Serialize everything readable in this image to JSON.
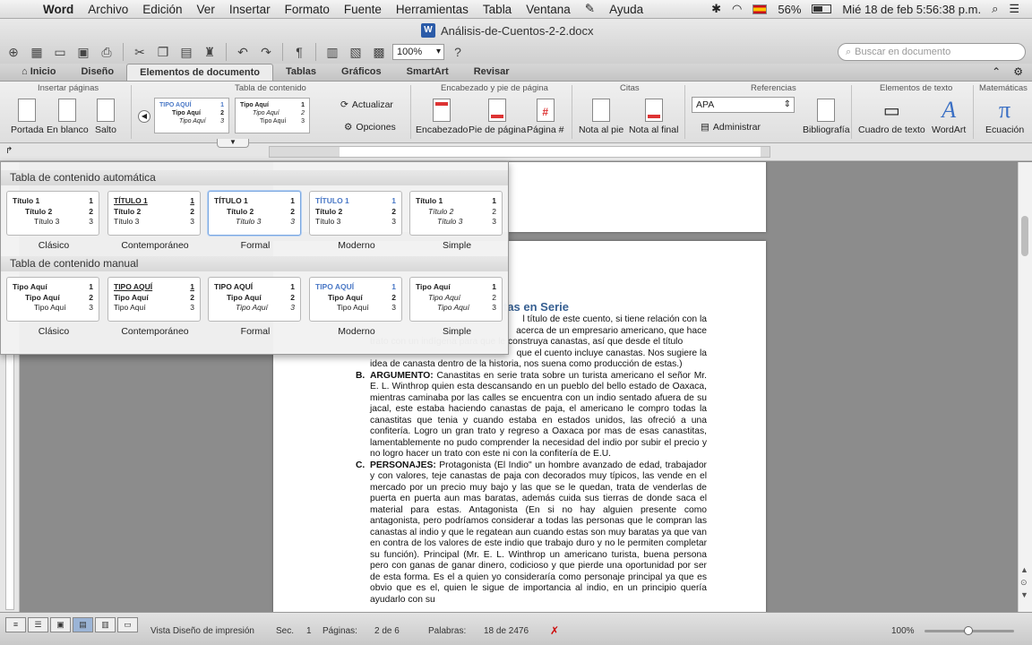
{
  "menubar": {
    "items": [
      "Word",
      "Archivo",
      "Edición",
      "Ver",
      "Insertar",
      "Formato",
      "Fuente",
      "Herramientas",
      "Tabla",
      "Ventana",
      "Ayuda"
    ],
    "battery": "56%",
    "clock": "Mié 18 de feb  5:56:38 p.m."
  },
  "window": {
    "title": "Análisis-de-Cuentos-2-2.docx",
    "zoom": "100%",
    "search_placeholder": "Buscar en documento"
  },
  "ribbon_tabs": [
    "Inicio",
    "Diseño",
    "Elementos de documento",
    "Tablas",
    "Gráficos",
    "SmartArt",
    "Revisar"
  ],
  "ribbon": {
    "groups": {
      "insertar_paginas": "Insertar páginas",
      "tabla_contenido": "Tabla de contenido",
      "encabezado": "Encabezado y pie de página",
      "citas": "Citas",
      "referencias": "Referencias",
      "elementos_texto": "Elementos de texto",
      "matematicas": "Matemáticas"
    },
    "buttons": {
      "portada": "Portada",
      "en_blanco": "En blanco",
      "salto": "Salto",
      "actualizar": "Actualizar",
      "opciones": "Opciones",
      "encabezado": "Encabezado",
      "pie_pagina": "Pie de página",
      "pagina_num": "Página #",
      "nota_pie": "Nota al pie",
      "nota_final": "Nota al final",
      "administrar": "Administrar",
      "bibliografia": "Bibliografía",
      "cuadro_texto": "Cuadro de texto",
      "wordart": "WordArt",
      "ecuacion": "Ecuación"
    },
    "style_value": "APA",
    "toc_thumb1": [
      "TIPO AQUÍ",
      "Tipo Aquí",
      "Tipo Aquí"
    ],
    "toc_thumb2": [
      "Tipo Aquí",
      "Tipo Aquí",
      "Tipo Aquí"
    ]
  },
  "gallery": {
    "auto_header": "Tabla de contenido automática",
    "manual_header": "Tabla de contenido manual",
    "auto_items": [
      {
        "caption": "Clásico",
        "l1": "Título 1",
        "l2": "Título 2",
        "l3": "Título 3"
      },
      {
        "caption": "Contemporáneo",
        "l1": "TÍTULO 1",
        "l2": "Título 2",
        "l3": "Título 3"
      },
      {
        "caption": "Formal",
        "l1": "TÍTULO 1",
        "l2": "Título 2",
        "l3": "Título 3"
      },
      {
        "caption": "Moderno",
        "l1": "TÍTULO 1",
        "l2": "Título 2",
        "l3": "Título 3"
      },
      {
        "caption": "Simple",
        "l1": "Título 1",
        "l2": "Título 2",
        "l3": "Título 3"
      }
    ],
    "manual_items": [
      {
        "caption": "Clásico",
        "l1": "Tipo Aquí",
        "l2": "Tipo Aquí",
        "l3": "Tipo Aquí"
      },
      {
        "caption": "Contemporáneo",
        "l1": "TIPO AQUÍ",
        "l2": "Tipo Aquí",
        "l3": "Tipo Aquí"
      },
      {
        "caption": "Formal",
        "l1": "TIPO AQUÍ",
        "l2": "Tipo Aquí",
        "l3": "Tipo Aquí"
      },
      {
        "caption": "Moderno",
        "l1": "TIPO AQUÍ",
        "l2": "Tipo Aquí",
        "l3": "Tipo Aquí"
      },
      {
        "caption": "Simple",
        "l1": "Tipo Aquí",
        "l2": "Tipo Aquí",
        "l3": "Tipo Aquí"
      }
    ],
    "page_nums": [
      "1",
      "2",
      "3"
    ]
  },
  "document": {
    "heading": "tas en Serie",
    "intro_lines": [
      "l título de este cuento, si tiene relación con la",
      "acerca de un empresario americano, que hace",
      "trato con un indígena para que le construya canastas, así que desde el título",
      "que el cuento incluye canastas. Nos sugiere la",
      "idea de canasta dentro de la historia, nos suena como producción de estas.)"
    ],
    "sections": [
      {
        "label": "B.",
        "title": "ARGUMENTO:",
        "text": "Canastitas en serie trata sobre un turista americano el señor Mr. E. L. Winthrop quien esta descansando en un pueblo del bello estado de Oaxaca, mientras caminaba por las calles se encuentra con un indio sentado afuera de su  jacal, este estaba haciendo canastas de paja, el americano le compro todas la canastitas que tenia y cuando estaba en estados unidos, las ofreció a una confitería. Logro un gran trato y regreso a Oaxaca por mas de esas canastitas, lamentablemente no pudo comprender la necesidad del indio por subir el precio y no logro hacer un trato con este ni con la confitería de E.U."
      },
      {
        "label": "C.",
        "title": "PERSONAJES:",
        "text": "Protagonista (El Indio\" un hombre avanzado de edad, trabajador y con valores, teje canastas de paja con decorados muy típicos, las vende en el mercado por un precio muy bajo y las que se le quedan, trata de  venderlas de  puerta en puerta aun mas baratas, además cuida sus tierras de donde saca el material para estas. Antagonista (En si no hay alguien presente como antagonista, pero podríamos considerar  a todas las personas que le compran las canastas al indio y que le regatean aun cuando estas son muy baratas ya que van en contra de los valores de este indio que trabajo duro y no le permiten completar su función). Principal (Mr. E. L. Winthrop un americano turista, buena persona pero con ganas de ganar dinero, codicioso y que pierde una oportunidad por ser de esta forma. Es el a quien yo consideraría como personaje principal ya que es obvio que es el, quien le sigue de importancia al indio, en un principio quería ayudarlo con su"
      }
    ]
  },
  "statusbar": {
    "view_label": "Vista Diseño de impresión",
    "sec_label": "Sec.",
    "sec_value": "1",
    "pages_label": "Páginas:",
    "pages_value": "2 de 6",
    "words_label": "Palabras:",
    "words_value": "18 de 2476",
    "zoom": "100%"
  }
}
